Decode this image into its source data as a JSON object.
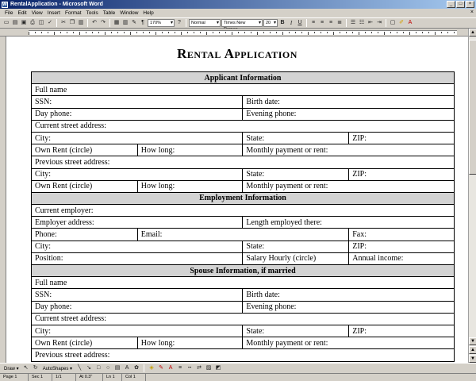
{
  "window": {
    "title": "RentalApplication - Microsoft Word",
    "app_icon": "W",
    "buttons": [
      "_",
      "□",
      "×"
    ]
  },
  "menu": {
    "items": [
      "File",
      "Edit",
      "View",
      "Insert",
      "Format",
      "Tools",
      "Table",
      "Window",
      "Help"
    ],
    "close_glyph": "×"
  },
  "toolbar": {
    "zoom": "170%",
    "style": "Normal",
    "font": "Times New Roman",
    "size": "20",
    "bold": "B",
    "italic": "I",
    "underline": "U",
    "icons": [
      "new-icon",
      "open-icon",
      "save-icon",
      "print-icon",
      "preview-icon",
      "spell-icon",
      "cut-icon",
      "copy-icon",
      "paste-icon",
      "undo-icon",
      "redo-icon",
      "table-icon",
      "columns-icon",
      "drawing-icon",
      "show-hide-icon"
    ]
  },
  "document": {
    "title": "Rental Application",
    "sections": {
      "applicant": "Applicant Information",
      "employment": "Employment Information",
      "spouse": "Spouse Information, if married"
    },
    "fields": {
      "full_name": "Full name",
      "ssn": "SSN:",
      "birth_date": "Birth date:",
      "day_phone": "Day phone:",
      "evening_phone": "Evening phone:",
      "current_address": "Current street address:",
      "city": "City:",
      "state": "State:",
      "zip": "ZIP:",
      "own_rent": "Own    Rent    (circle)",
      "how_long": "How long:",
      "monthly_payment": "Monthly payment or rent:",
      "previous_address": "Previous street address:",
      "current_employer": "Current employer:",
      "employer_address": "Employer address:",
      "length_employed": "Length employed there:",
      "phone": "Phone:",
      "email": "Email:",
      "fax": "Fax:",
      "position": "Position:",
      "salary_hourly": "Salary   Hourly  (circle)",
      "annual_income": "Annual income:"
    }
  },
  "drawbar": {
    "draw": "Draw ▾",
    "autoshapes": "AutoShapes ▾"
  },
  "status": {
    "page": "Page 1",
    "sec": "Sec 1",
    "pages": "1/1",
    "at": "At 0.3\"",
    "ln": "Ln 1",
    "col": "Col 1"
  }
}
